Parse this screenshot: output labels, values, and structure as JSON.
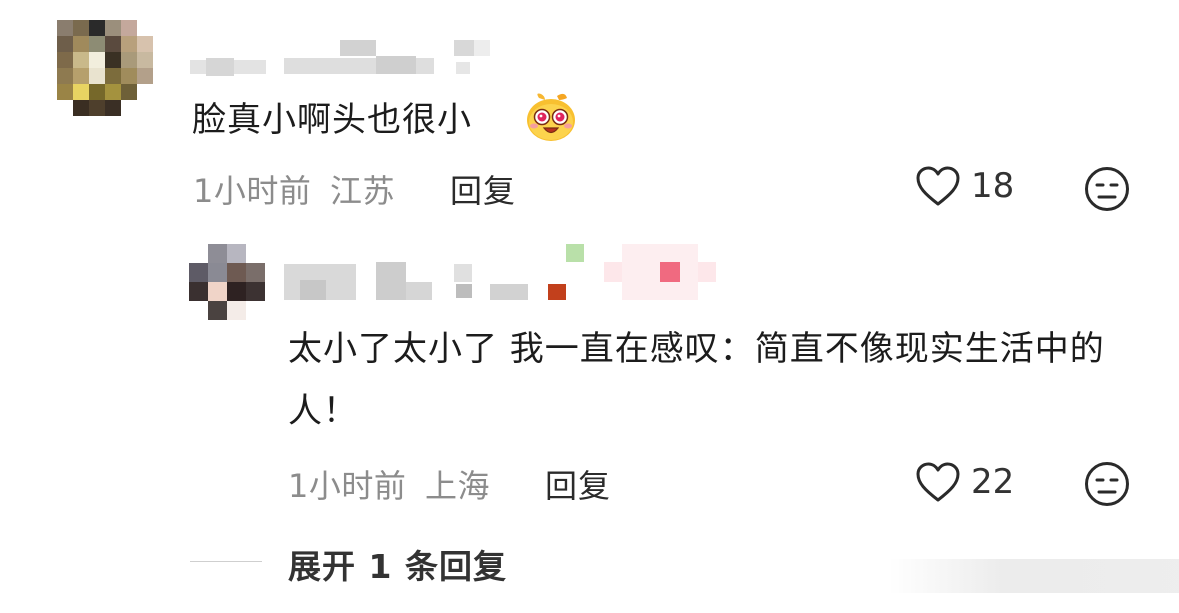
{
  "comment": {
    "text": "脸真小啊头也很小",
    "emoji_icon": "face-with-star-eyes-icon",
    "time": "1小时前",
    "location": "江苏",
    "reply_label": "回复",
    "likes": "18",
    "avatar_colors": [
      "#8a7d6e",
      "#7a6a4e",
      "#2a2a2a",
      "#9b8f7c",
      "#c4a89c",
      "#ffffff",
      "#6e5e4a",
      "#a08a5c",
      "#8d8c74",
      "#5a4a3e",
      "#b8a07c",
      "#d7c2ad",
      "#7e6a4a",
      "#c9b98a",
      "#f2eedd",
      "#3a3124",
      "#a99a7a",
      "#c8b9a0",
      "#8e7a50",
      "#b6a06c",
      "#e9e3cf",
      "#7c6c3c",
      "#a08c5c",
      "#b3a08a",
      "#9a8446",
      "#e8d462",
      "#76682a",
      "#a4923e",
      "#6e6038",
      "#ffffff",
      "#ffffff",
      "#3a2e22",
      "#4e3f2c",
      "#3a2f25",
      "#ffffff",
      "#ffffff"
    ]
  },
  "reply": {
    "text": "太小了太小了 我一直在感叹：简直不像现实生活中的人！",
    "time": "1小时前",
    "location": "上海",
    "reply_label": "回复",
    "likes": "22",
    "avatar_colors": [
      "#ffffff",
      "#8e8d96",
      "#b7b6c0",
      "#ffffff",
      "#5e5b66",
      "#8a8a94",
      "#6e5a52",
      "#7a6e6a",
      "#3a3030",
      "#f0d4c8",
      "#2e2222",
      "#3c3232",
      "#ffffff",
      "#4a4240",
      "#f4ece8",
      "#ffffff"
    ]
  },
  "expand_label": "展开 1 条回复",
  "icons": {
    "heart": "heart-outline-icon",
    "dislike": "meh-face-icon"
  }
}
